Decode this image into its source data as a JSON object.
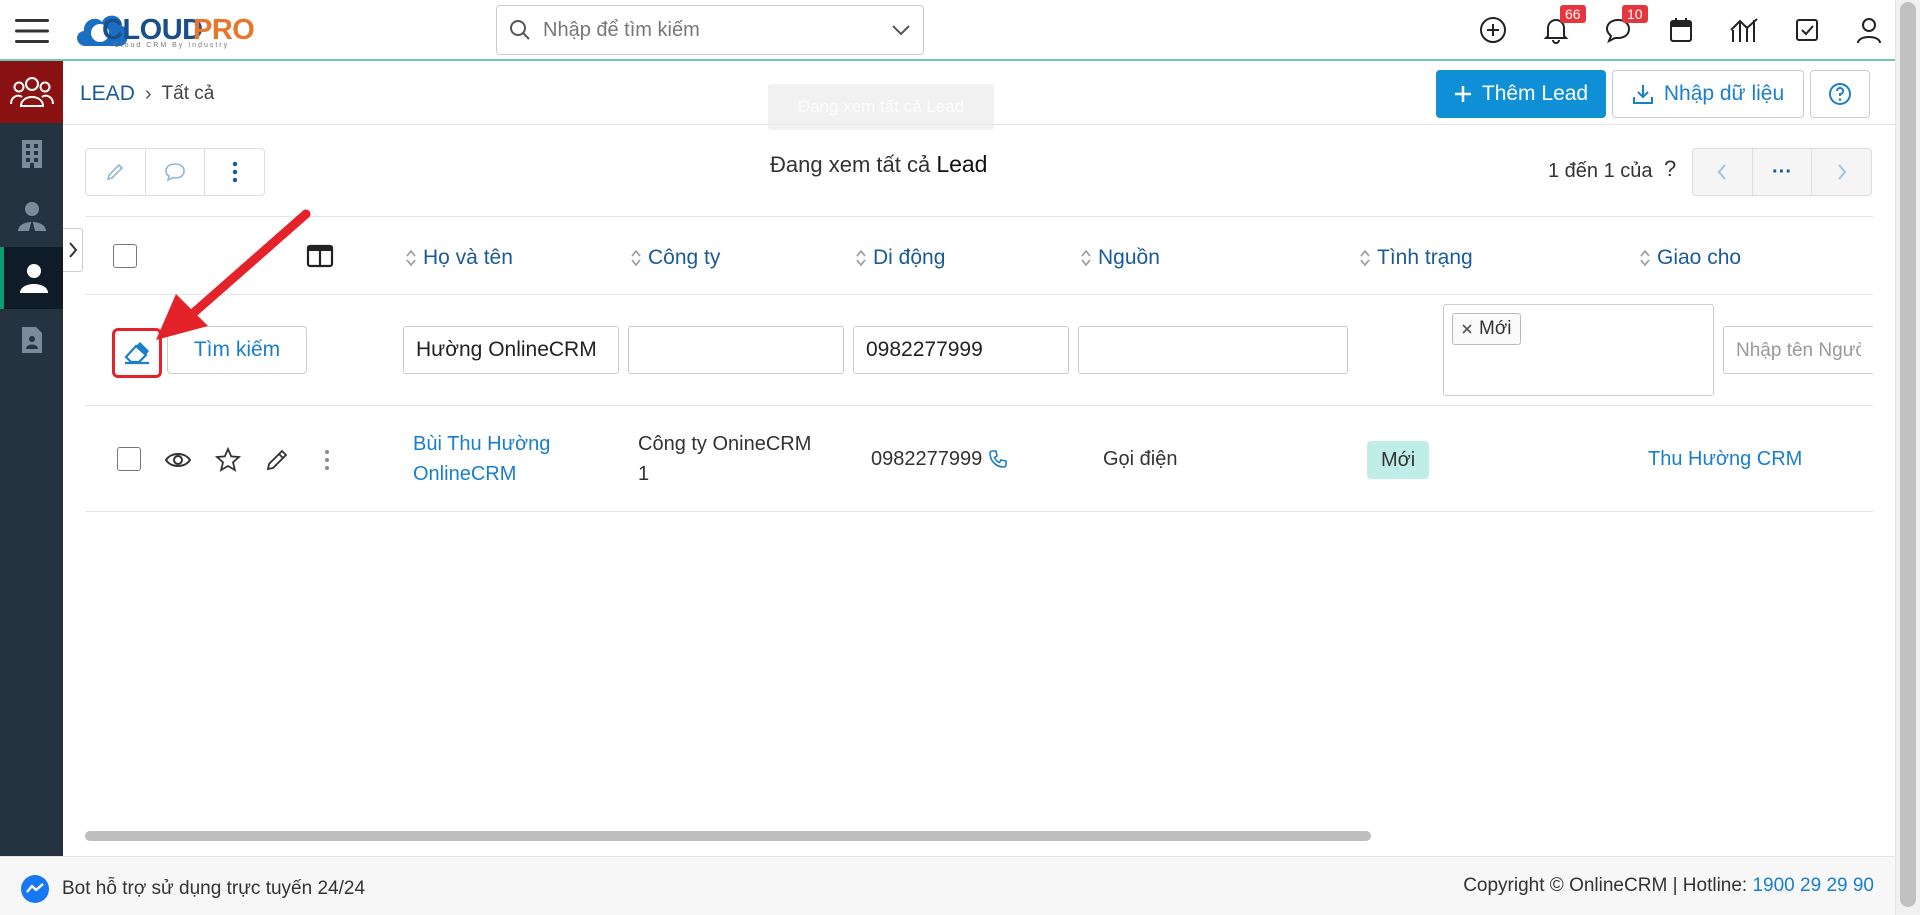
{
  "app": {
    "logo_word_1": "CLOUD",
    "logo_word_2": "PRO",
    "logo_tagline": "Cloud CRM By Industry",
    "accent_color": "#0f8fd6",
    "brand_red": "#8b1212"
  },
  "search": {
    "placeholder": "Nhập để tìm kiếm"
  },
  "topbar": {
    "notifications_badge": "66",
    "messages_badge": "10",
    "icons": [
      "plus-circle-icon",
      "bell-icon",
      "chat-icon",
      "calendar-icon",
      "chart-icon",
      "checkbox-icon",
      "user-icon"
    ]
  },
  "sidebar": {
    "items": [
      {
        "icon": "users-group-icon",
        "state": "active-red"
      },
      {
        "icon": "building-icon",
        "state": "normal"
      },
      {
        "icon": "contact-icon",
        "state": "normal"
      },
      {
        "icon": "lead-person-icon",
        "state": "active"
      },
      {
        "icon": "document-icon",
        "state": "normal"
      }
    ]
  },
  "breadcrumb": {
    "root": "LEAD",
    "separator": "›",
    "current": "Tất cả"
  },
  "tooltip": "Đang xem tất cả Lead",
  "actions": {
    "add_label": "Thêm Lead",
    "import_label": "Nhập dữ liệu"
  },
  "list": {
    "view_title_prefix": "Đang xem tất cả",
    "view_title_module": "Lead",
    "pager_text": "1 đến 1 của",
    "pager_unknown": "?",
    "pager_more": "···"
  },
  "table": {
    "columns": [
      "Họ và tên",
      "Công ty",
      "Di động",
      "Nguồn",
      "Tình trạng",
      "Giao cho"
    ],
    "filters": {
      "name": "Hường OnlineCRM",
      "company": "",
      "mobile": "0982277999",
      "source": "",
      "status_chip": "Mới",
      "assigned_placeholder": "Nhập tên Người dùng hoặc Nhóm"
    },
    "search_button": "Tìm kiếm",
    "rows": [
      {
        "name_line1": "Bùi Thu Hường",
        "name_line2": "OnlineCRM",
        "company_line1": "Công ty OnineCRM",
        "company_line2": "1",
        "mobile": "0982277999",
        "source": "Gọi điện",
        "status": "Mới",
        "status_color": "#bfeee8",
        "assigned_to": "Thu Hường CRM"
      }
    ]
  },
  "scroll": {
    "horizontal_position": 0
  },
  "footer": {
    "support_text": "Bot hỗ trợ sử dụng trực tuyến 24/24",
    "copyright": "Copyright © OnlineCRM",
    "hotline_label": "Hotline:",
    "hotline_number": "1900 29 29 90"
  },
  "annotation": {
    "color": "#e3222a"
  }
}
